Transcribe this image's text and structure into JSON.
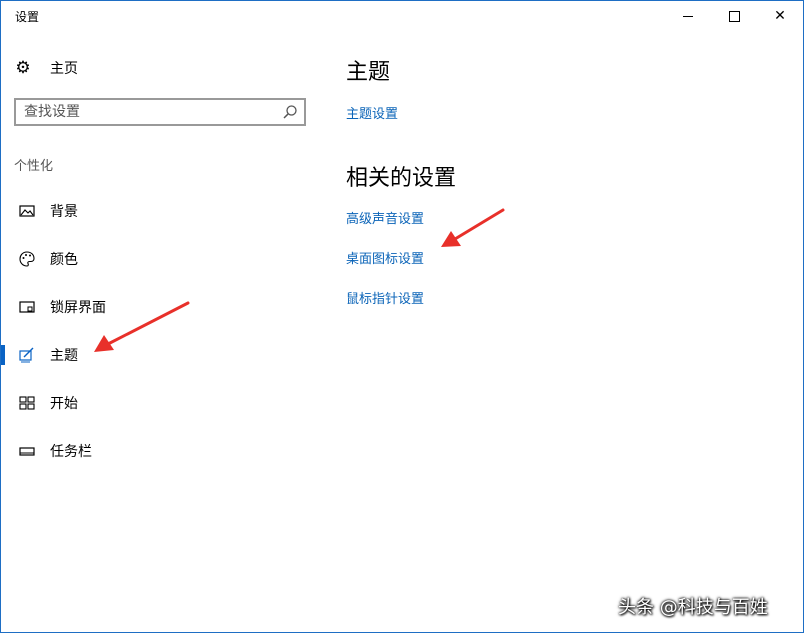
{
  "window": {
    "title": "设置",
    "minimize_glyph": "—",
    "maximize_glyph": "☐",
    "close_glyph": "✕"
  },
  "sidebar": {
    "home_label": "主页",
    "home_icon": "gear-icon",
    "search_placeholder": "查找设置",
    "search_icon": "search-icon",
    "section_label": "个性化",
    "items": [
      {
        "label": "背景",
        "icon": "picture-icon"
      },
      {
        "label": "颜色",
        "icon": "palette-icon"
      },
      {
        "label": "锁屏界面",
        "icon": "lock-screen-icon"
      },
      {
        "label": "主题",
        "icon": "theme-brush-icon",
        "selected": true
      },
      {
        "label": "开始",
        "icon": "start-tiles-icon"
      },
      {
        "label": "任务栏",
        "icon": "taskbar-icon"
      }
    ]
  },
  "main": {
    "title": "主题",
    "theme_settings_link": "主题设置",
    "related_title": "相关的设置",
    "related_links": [
      "高级声音设置",
      "桌面图标设置",
      "鼠标指针设置"
    ]
  },
  "colors": {
    "accent": "#0a63c4",
    "link": "#0b64b8",
    "annotation_arrow": "#e8302a"
  },
  "watermark": "头条 @科技与百姓"
}
